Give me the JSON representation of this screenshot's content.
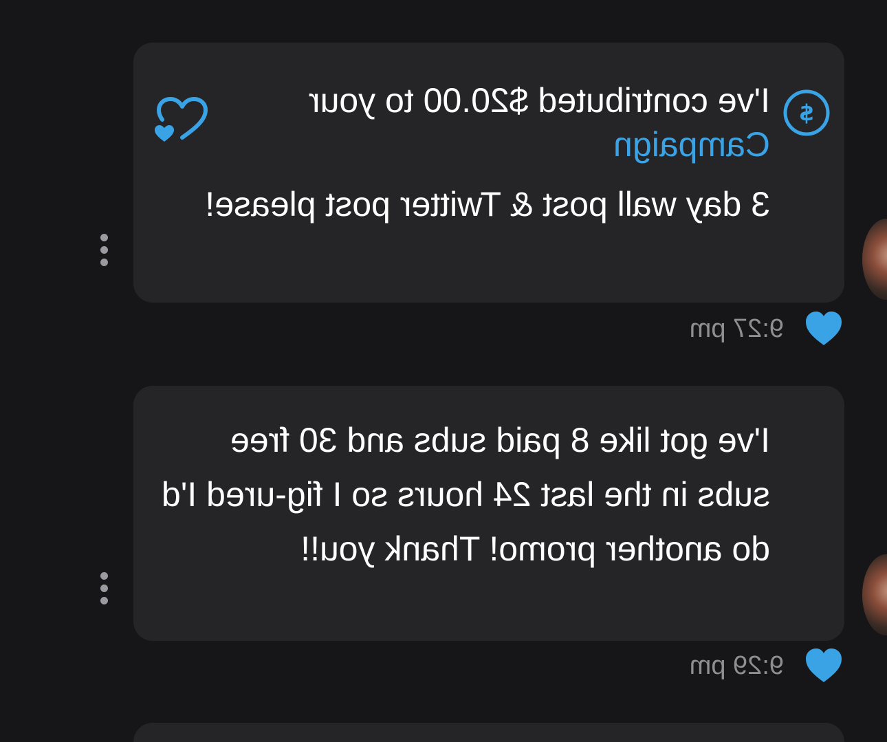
{
  "messages": [
    {
      "contribution_text": "I've contributed $20.00 to your",
      "contribution_link": "Campaign",
      "text": "3 day wall post & Twitter post please!",
      "time": "9:27 pm",
      "icons": {
        "contribution": "dollar-circle-icon",
        "support": "heart-outline-icon",
        "like": "heart-filled-icon",
        "menu": "more-vertical-icon"
      }
    },
    {
      "text": "I've got like 8 paid subs and 30 free subs in the last 24 hours so I fig-ured I'd do another promo! Thank you!!",
      "time": "9:29 pm",
      "icons": {
        "like": "heart-filled-icon",
        "menu": "more-vertical-icon"
      }
    }
  ],
  "colors": {
    "background": "#161618",
    "bubble": "#252528",
    "accent": "#3aa3e5",
    "text": "#ffffff",
    "meta_text": "#8e8e93"
  },
  "mirrored": true
}
